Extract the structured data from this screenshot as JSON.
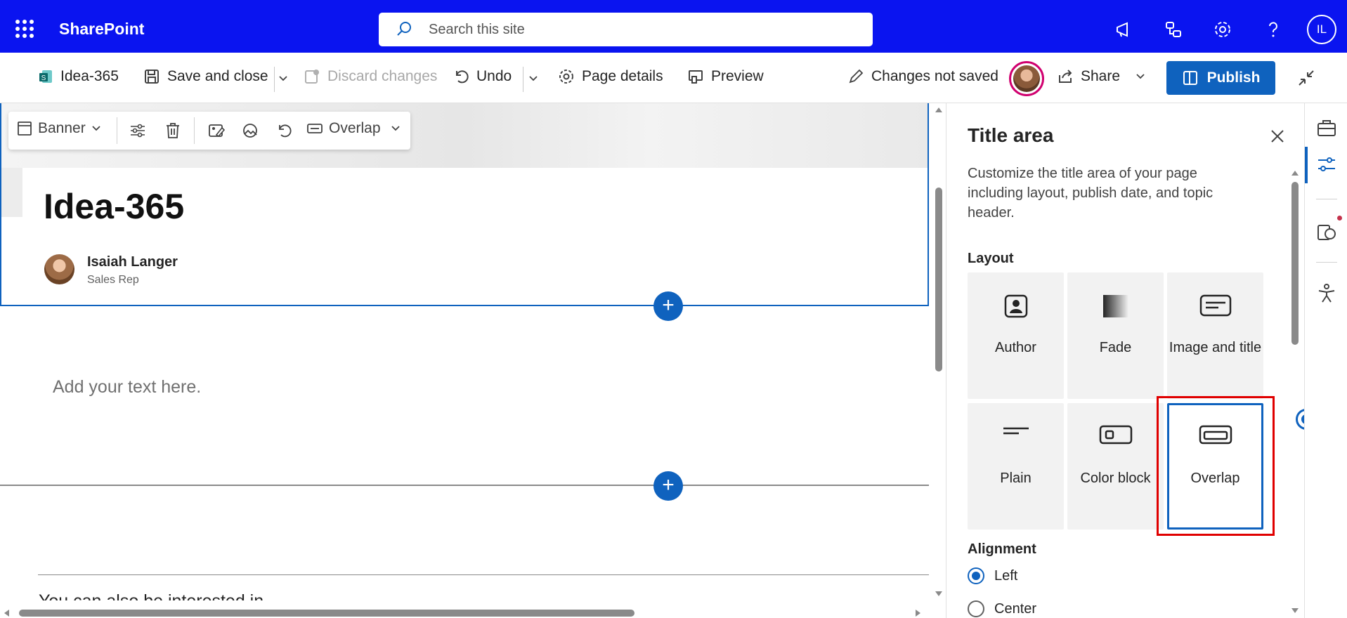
{
  "topbar": {
    "brand": "SharePoint",
    "search_placeholder": "Search this site",
    "user_initials": "IL",
    "icons": [
      "waffle-icon",
      "megaphone-icon",
      "connections-icon",
      "gear-icon",
      "help-icon"
    ]
  },
  "commandbar": {
    "page_name": "Idea-365",
    "save_close": "Save and close",
    "discard": "Discard changes",
    "undo": "Undo",
    "page_details": "Page details",
    "preview": "Preview",
    "status": "Changes not saved",
    "share": "Share",
    "publish": "Publish"
  },
  "canvas": {
    "toolbar": {
      "banner": "Banner",
      "overlap": "Overlap"
    },
    "page_title": "Idea-365",
    "author_name": "Isaiah Langer",
    "author_role": "Sales Rep",
    "text_placeholder": "Add your text here.",
    "cut_text": "You can also be interested in"
  },
  "panel": {
    "title": "Title area",
    "description": "Customize the title area of your page including layout, publish date, and topic header.",
    "layout_label": "Layout",
    "layouts": [
      {
        "label": "Author",
        "icon": "author-icon"
      },
      {
        "label": "Fade",
        "icon": "fade-icon"
      },
      {
        "label": "Image and title",
        "icon": "image-title-icon"
      },
      {
        "label": "Plain",
        "icon": "plain-icon"
      },
      {
        "label": "Color block",
        "icon": "color-block-icon"
      },
      {
        "label": "Overlap",
        "icon": "overlap-icon",
        "selected": true
      }
    ],
    "alignment_label": "Alignment",
    "alignment_options": [
      {
        "label": "Left",
        "checked": true
      },
      {
        "label": "Center",
        "checked": false
      }
    ]
  },
  "colors": {
    "topbar": "#0a14f0",
    "accent": "#0f62be",
    "highlight": "#e00000"
  }
}
